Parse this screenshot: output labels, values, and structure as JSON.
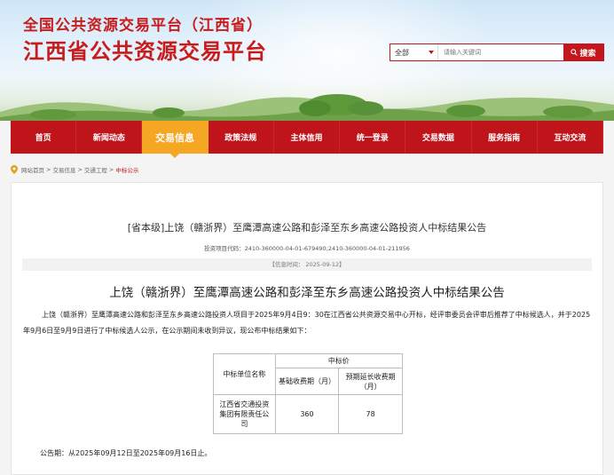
{
  "site": {
    "title_line1": "全国公共资源交易平台（江西省）",
    "title_line2": "江西省公共资源交易平台"
  },
  "search": {
    "scope": "全部",
    "placeholder": "请输入关键词",
    "button_label": "搜索"
  },
  "nav": {
    "items": [
      {
        "label": "首页"
      },
      {
        "label": "新闻动态"
      },
      {
        "label": "交易信息"
      },
      {
        "label": "政策法规"
      },
      {
        "label": "主体信用"
      },
      {
        "label": "统一登录"
      },
      {
        "label": "交易数据"
      },
      {
        "label": "服务指南"
      },
      {
        "label": "互动交流"
      }
    ],
    "active_index": 2
  },
  "breadcrumb": {
    "items": [
      "网站首页",
      "交易信息",
      "交通工程",
      "中标公示"
    ],
    "separator": ">"
  },
  "article": {
    "title": "[省本级]上饶（赣浙界）至鹰潭高速公路和彭泽至东乡高速公路投资人中标结果公告",
    "code_line": "投资项目代码：2410-360000-04-01-679490;2410-360000-04-01-211956",
    "date_line": "【信息时间： 2025-09-12】",
    "subtitle": "上饶（赣浙界）至鹰潭高速公路和彭泽至东乡高速公路投资人中标结果公告",
    "paragraph": "上饶（赣浙界）至鹰潭高速公路和彭泽至东乡高速公路投资人项目于2025年9月4日9：30在江西省公共资源交易中心开标，经评审委员会评审后推荐了中标候选人，并于2025年9月6日至9月9日进行了中标候选人公示，在公示期间未收到异议，现公布中标结果如下：",
    "table": {
      "col_unit": "中标单位名称",
      "col_price": "中标价",
      "col_base": "基础收费期（月）",
      "col_ext": "预期延长收费期（月）",
      "row_unit": "江西省交通投资集团有限责任公司",
      "row_base": "360",
      "row_ext": "78"
    },
    "notice": "公告期：从2025年09月12日至2025年09月16日止。"
  },
  "colors": {
    "brand_red": "#c0141b",
    "active_orange": "#f5a623"
  }
}
